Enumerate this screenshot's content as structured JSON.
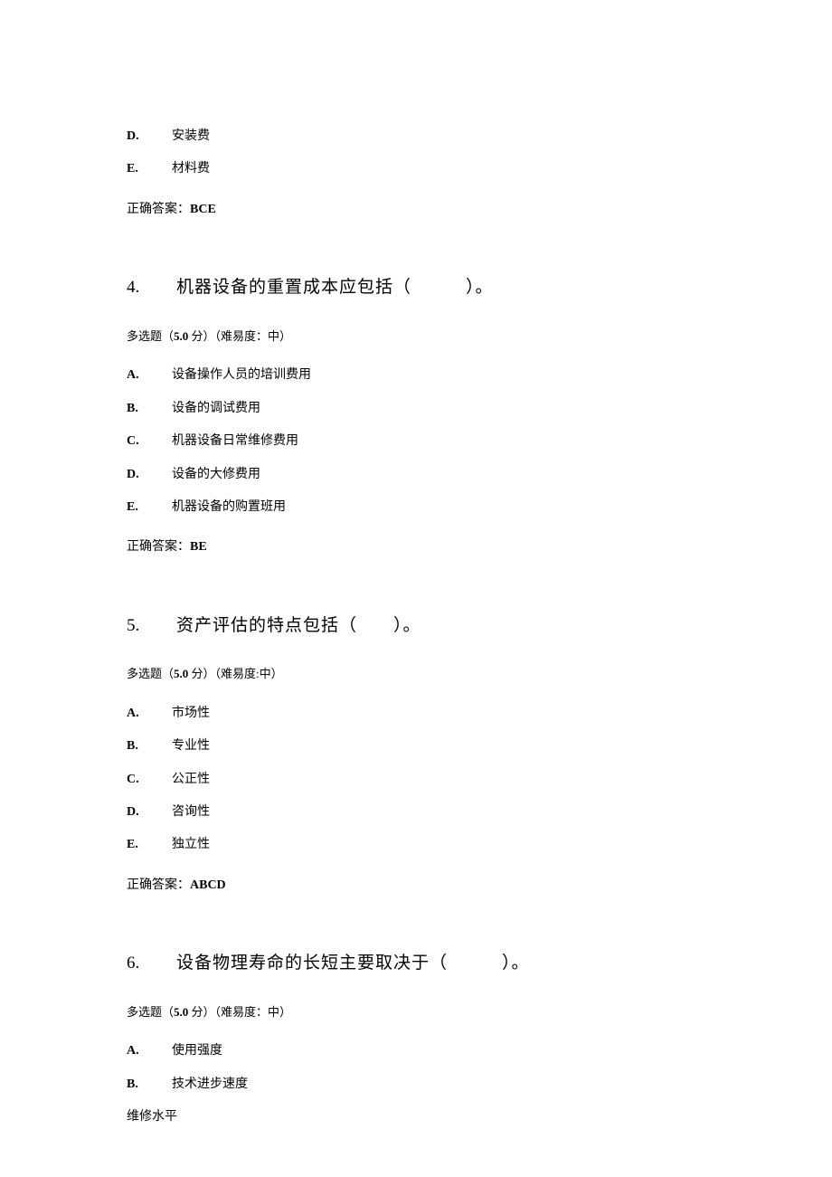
{
  "q3": {
    "options": [
      {
        "letter": "D.",
        "text": "安装费"
      },
      {
        "letter": "E.",
        "text": "材料费"
      }
    ],
    "answer_label": "正确答案：",
    "answer_value": "BCE"
  },
  "q4": {
    "num": "4.",
    "title": "机器设备的重置成本应包括（　　　）。",
    "meta_prefix": "多选题（",
    "meta_points": "5.0",
    "meta_suffix": " 分）（难易度：中）",
    "options": [
      {
        "letter": "A.",
        "text": "设备操作人员的培训费用"
      },
      {
        "letter": "B.",
        "text": "设备的调试费用"
      },
      {
        "letter": "C.",
        "text": "机器设备日常维修费用"
      },
      {
        "letter": "D.",
        "text": "设备的大修费用"
      },
      {
        "letter": "E.",
        "text": "机器设备的购置班用"
      }
    ],
    "answer_label": "正确答案：",
    "answer_value": "BE"
  },
  "q5": {
    "num": "5.",
    "title": "资产评估的特点包括（　　）。",
    "meta_prefix": "多选题（",
    "meta_points": "5.0",
    "meta_suffix": " 分）（难易度:中）",
    "options": [
      {
        "letter": "A.",
        "text": "市场性"
      },
      {
        "letter": "B.",
        "text": "专业性"
      },
      {
        "letter": "C.",
        "text": "公正性"
      },
      {
        "letter": "D.",
        "text": "咨询性"
      },
      {
        "letter": "E.",
        "text": "独立性"
      }
    ],
    "answer_label": "正确答案：",
    "answer_value": "ABCD"
  },
  "q6": {
    "num": "6.",
    "title": "设备物理寿命的长短主要取决于（　　　）。",
    "meta_prefix": "多选题（",
    "meta_points": "5.0",
    "meta_suffix": " 分）（难易度：中）",
    "options": [
      {
        "letter": "A.",
        "text": "使用强度"
      },
      {
        "letter": "B.",
        "text": "技术进步速度"
      }
    ],
    "orphan": "维修水平"
  }
}
